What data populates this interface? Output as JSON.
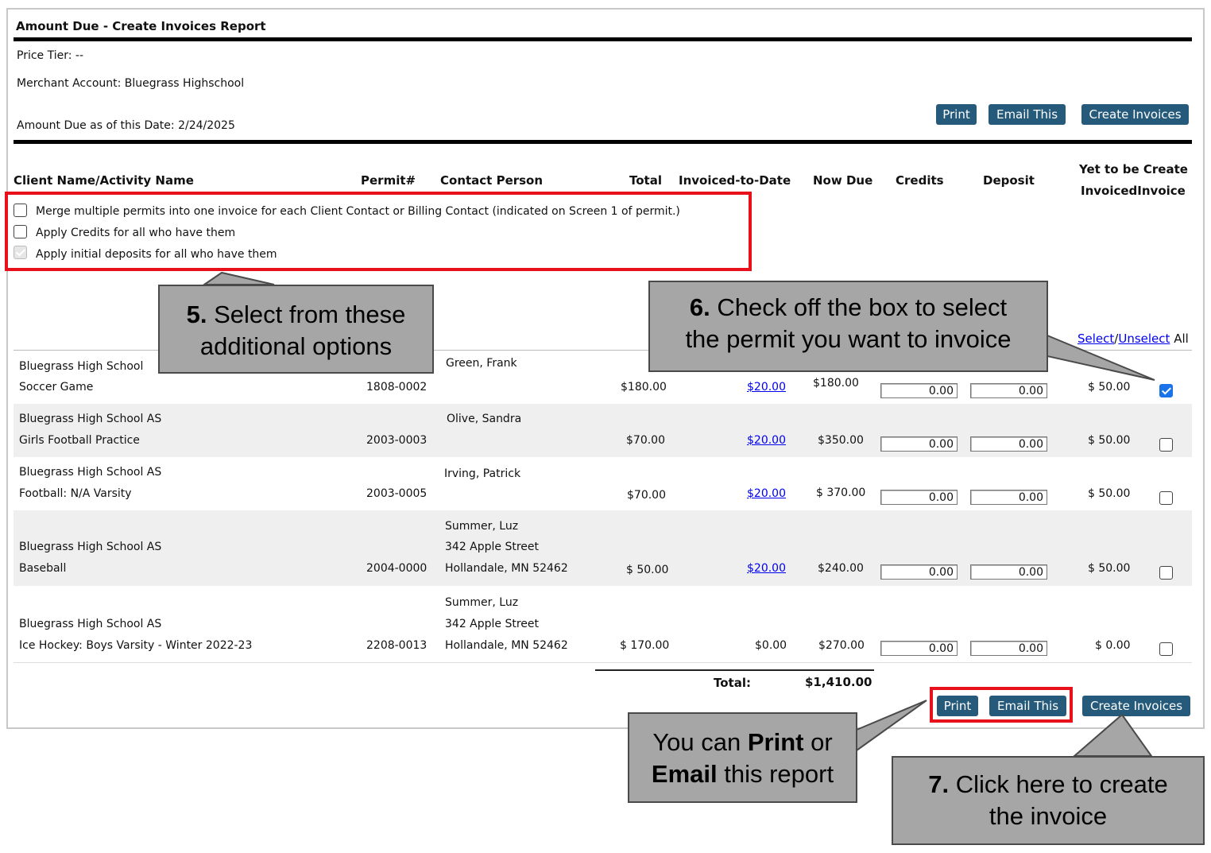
{
  "report": {
    "title": "Amount Due - Create Invoices Report",
    "price_tier": "Price Tier:  --",
    "merchant_account": "Merchant Account: Bluegrass Highschool",
    "as_of_date": "Amount Due as of this Date: 2/24/2025"
  },
  "buttons": {
    "print": "Print",
    "email": "Email This",
    "create": "Create Invoices"
  },
  "columns": {
    "client": "Client Name/Activity Name",
    "permit": "Permit#",
    "contact": "Contact Person",
    "total": "Total",
    "invoiced": "Invoiced-to-Date",
    "now_due": "Now Due",
    "credits": "Credits",
    "deposit": "Deposit",
    "yet_line1": "Yet to be Create",
    "yet_line2": "InvoicedInvoice"
  },
  "options": [
    {
      "label": "Merge multiple permits into one invoice for each Client Contact or Billing Contact (indicated on Screen 1 of permit.)",
      "checked": false,
      "disabled": false
    },
    {
      "label": "Apply Credits for all who have them",
      "checked": false,
      "disabled": false
    },
    {
      "label": "Apply initial deposits for all who have them",
      "checked": true,
      "disabled": true
    }
  ],
  "select_all": {
    "select": "Select",
    "sep": "/",
    "unselect": "Unselect",
    "all": "All"
  },
  "rows": [
    {
      "client": "Bluegrass High School",
      "activity": "Soccer Game",
      "permit": "1808-0002",
      "contact": [
        "Green, Frank"
      ],
      "total": "$180.00",
      "invoiced": "$20.00",
      "invoiced_link": true,
      "now_due": "$180.00",
      "credits": "0.00",
      "deposit": "0.00",
      "yet": "$ 50.00",
      "selected": true
    },
    {
      "client": "Bluegrass High School AS",
      "activity": "Girls Football Practice",
      "permit": "2003-0003",
      "contact": [
        "Olive, Sandra"
      ],
      "total": "$70.00",
      "invoiced": "$20.00",
      "invoiced_link": true,
      "now_due": "$350.00",
      "credits": "0.00",
      "deposit": "0.00",
      "yet": "$ 50.00",
      "selected": false
    },
    {
      "client": "Bluegrass High School AS",
      "activity": "Football: N/A Varsity",
      "permit": "2003-0005",
      "contact": [
        "Irving, Patrick"
      ],
      "total": "$70.00",
      "invoiced": "$20.00",
      "invoiced_link": true,
      "now_due": "$ 370.00",
      "credits": "0.00",
      "deposit": "0.00",
      "yet": "$ 50.00",
      "selected": false
    },
    {
      "client": "Bluegrass High School AS",
      "activity": "Baseball",
      "permit": "2004-0000",
      "contact": [
        "Summer, Luz",
        "342 Apple Street",
        "Hollandale, MN 52462"
      ],
      "total": "$ 50.00",
      "invoiced": "$20.00",
      "invoiced_link": true,
      "now_due": "$240.00",
      "credits": "0.00",
      "deposit": "0.00",
      "yet": "$ 50.00",
      "selected": false
    },
    {
      "client": "Bluegrass High School AS",
      "activity": "Ice Hockey: Boys Varsity - Winter 2022-23",
      "permit": "2208-0013",
      "contact": [
        "Summer, Luz",
        "342 Apple Street",
        "Hollandale, MN 52462"
      ],
      "total": "$ 170.00",
      "invoiced": "$0.00",
      "invoiced_link": false,
      "now_due": "$270.00",
      "credits": "0.00",
      "deposit": "0.00",
      "yet": "$ 0.00",
      "selected": false
    }
  ],
  "totals": {
    "label": "Total:",
    "value": "$1,410.00"
  },
  "callouts": {
    "c5_num": "5.",
    "c5_line1": "Select from these",
    "c5_line2": "additional options",
    "c6_num": "6.",
    "c6_line1": "Check off the box to select",
    "c6_line2": "the permit you want to invoice",
    "print_pre": "You can ",
    "print_b1": "Print",
    "print_mid": " or",
    "print_b2": "Email",
    "print_post": " this report",
    "c7_num": "7.",
    "c7_line1": "Click here to create",
    "c7_line2": "the invoice"
  },
  "colors": {
    "button": "#255a7b",
    "highlight": "#e8101a",
    "callout": "#a6a6a6",
    "link": "#0000ee"
  }
}
